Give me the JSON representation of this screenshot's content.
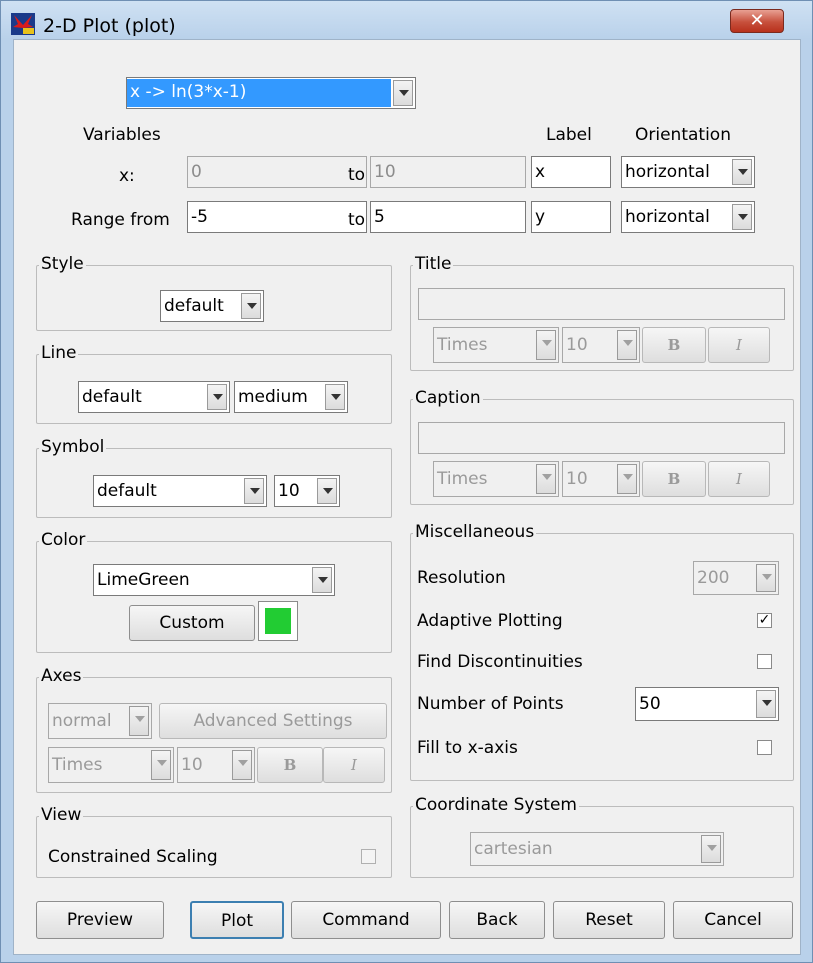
{
  "window": {
    "title": "2-D Plot (plot)",
    "close_label": "✕"
  },
  "function_select": {
    "value": "x -> ln(3*x-1)"
  },
  "headers": {
    "variables": "Variables",
    "label": "Label",
    "orientation": "Orientation"
  },
  "x_row": {
    "label": "x:",
    "from": "0",
    "to_label": "to",
    "to": "10",
    "axis_label": "x",
    "orientation": "horizontal"
  },
  "range_row": {
    "label": "Range from",
    "from": "-5",
    "to_label": "to",
    "to": "5",
    "axis_label": "y",
    "orientation": "horizontal"
  },
  "style": {
    "title": "Style",
    "value": "default"
  },
  "line": {
    "title": "Line",
    "type": "default",
    "width": "medium"
  },
  "symbol": {
    "title": "Symbol",
    "type": "default",
    "size": "10"
  },
  "color": {
    "title": "Color",
    "value": "LimeGreen",
    "custom_label": "Custom",
    "swatch": "#22cc33"
  },
  "axes": {
    "title": "Axes",
    "mode": "normal",
    "advanced_label": "Advanced Settings",
    "font": "Times",
    "size": "10",
    "bold": "B",
    "italic": "I"
  },
  "view": {
    "title": "View",
    "constrained_label": "Constrained Scaling",
    "constrained_checked": false
  },
  "title_group": {
    "title": "Title",
    "text": "",
    "font": "Times",
    "size": "10",
    "bold": "B",
    "italic": "I"
  },
  "caption_group": {
    "title": "Caption",
    "text": "",
    "font": "Times",
    "size": "10",
    "bold": "B",
    "italic": "I"
  },
  "misc": {
    "title": "Miscellaneous",
    "resolution_label": "Resolution",
    "resolution": "200",
    "adaptive_label": "Adaptive Plotting",
    "adaptive_checked": true,
    "discont_label": "Find Discontinuities",
    "discont_checked": false,
    "points_label": "Number of Points",
    "points": "50",
    "fill_label": "Fill to x-axis",
    "fill_checked": false
  },
  "coord": {
    "title": "Coordinate System",
    "value": "cartesian"
  },
  "buttons": {
    "preview": "Preview",
    "plot": "Plot",
    "command": "Command",
    "back": "Back",
    "reset": "Reset",
    "cancel": "Cancel"
  },
  "colors": {
    "titlebar": "#b9d1ea",
    "selection": "#3399ff",
    "close": "#c7503c"
  }
}
